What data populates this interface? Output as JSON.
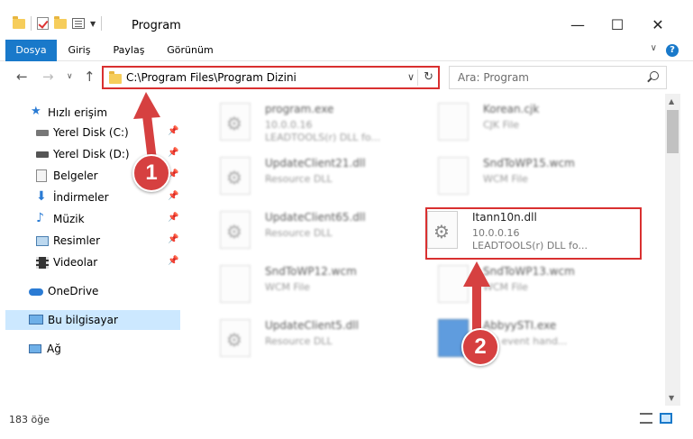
{
  "window": {
    "title": "Program",
    "minimize": "—",
    "maximize": "☐",
    "close": "✕"
  },
  "ribbon": {
    "tabs": [
      "Dosya",
      "Giriş",
      "Paylaş",
      "Görünüm"
    ],
    "help": "?"
  },
  "address": {
    "path": "C:\\Program Files\\Program Dizini",
    "dropdown": "∨",
    "refresh": "↻"
  },
  "search": {
    "placeholder": "Ara: Program"
  },
  "nav": {
    "back": "←",
    "forward": "→",
    "up_menu": "∨",
    "up": "↑"
  },
  "sidebar": {
    "quick_access": "Hızlı erişim",
    "items": [
      {
        "label": "Yerel Disk (C:)",
        "icon": "drive-icon"
      },
      {
        "label": "Yerel Disk (D:)",
        "icon": "drive-icon"
      },
      {
        "label": "Belgeler",
        "icon": "documents-icon"
      },
      {
        "label": "İndirmeler",
        "icon": "downloads-icon"
      },
      {
        "label": "Müzik",
        "icon": "music-icon"
      },
      {
        "label": "Resimler",
        "icon": "pictures-icon"
      },
      {
        "label": "Videolar",
        "icon": "videos-icon"
      }
    ],
    "onedrive": "OneDrive",
    "this_pc": "Bu bilgisayar",
    "network": "Ağ"
  },
  "files": [
    {
      "name": "program.exe",
      "line2": "10.0.0.16",
      "line3": "LEADTOOLS(r) DLL fo..."
    },
    {
      "name": "Korean.cjk",
      "line2": "CJK File",
      "line3": ""
    },
    {
      "name": "UpdateClient21.dll",
      "line2": "Resource DLL",
      "line3": ""
    },
    {
      "name": "SndToWP15.wcm",
      "line2": "WCM File",
      "line3": ""
    },
    {
      "name": "UpdateClient65.dll",
      "line2": "Resource DLL",
      "line3": ""
    },
    {
      "name": "Itann10n.dll",
      "line2": "10.0.0.16",
      "line3": "LEADTOOLS(r) DLL fo..."
    },
    {
      "name": "SndToWP12.wcm",
      "line2": "WCM File",
      "line3": ""
    },
    {
      "name": "SndToWP13.wcm",
      "line2": "WCM File",
      "line3": ""
    },
    {
      "name": "UpdateClient5.dll",
      "line2": "Resource DLL",
      "line3": ""
    },
    {
      "name": "AbbyySTI.exe",
      "line2": "STI event hand...",
      "line3": ""
    }
  ],
  "status": {
    "count": "183 öğe"
  },
  "annotations": [
    "1",
    "2"
  ],
  "colors": {
    "accent": "#1979ca",
    "highlight": "#d93030",
    "arrow": "#d64040",
    "selection": "#cce8ff"
  }
}
